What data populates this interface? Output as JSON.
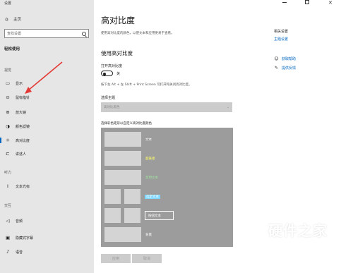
{
  "window": {
    "title": "设置",
    "close_glyph": "✕"
  },
  "sidebar": {
    "home_label": "主页",
    "search_placeholder": "查找设置",
    "section_title": "轻松使用",
    "groups": [
      {
        "label": "视觉"
      },
      {
        "label": "听力"
      },
      {
        "label": "交互"
      }
    ],
    "items": [
      {
        "label": "显示",
        "icon": "display-icon"
      },
      {
        "label": "鼠标指针",
        "icon": "pointer-icon"
      },
      {
        "label": "放大镜",
        "icon": "magnifier-icon"
      },
      {
        "label": "颜色滤镜",
        "icon": "color-filter-icon"
      },
      {
        "label": "高对比度",
        "icon": "contrast-icon"
      },
      {
        "label": "讲述人",
        "icon": "narrator-icon"
      },
      {
        "label": "文本光标",
        "icon": "text-cursor-icon"
      },
      {
        "label": "音频",
        "icon": "speaker-icon"
      },
      {
        "label": "隐藏式字幕",
        "icon": "captions-icon"
      },
      {
        "label": "语音",
        "icon": "microphone-icon"
      }
    ]
  },
  "main": {
    "title": "高对比度",
    "description": "使用高对比度的颜色，以使文本和应用更易于查看。",
    "section_title": "使用高对比度",
    "toggle_label": "打开高对比度",
    "toggle_state": "关",
    "hint": "按下左 Alt + 左 Shift + Print Screen 可打开和关闭高对比度。",
    "theme_label": "选择主题",
    "theme_value": "高对比黑色",
    "color_label": "选择彩色矩形以自定义高对比度颜色",
    "preview": {
      "text": "文本",
      "hyperlink": "超链接",
      "disabled_text": "禁用文本",
      "selected_text": "选定文本",
      "button_text": "按钮文本",
      "background": "背景"
    },
    "apply_label": "应用",
    "cancel_label": "取消"
  },
  "right": {
    "heading": "相关设置",
    "theme_link": "主题设置",
    "help_link": "获取帮助",
    "feedback_link": "提供反馈"
  },
  "watermark": {
    "main": "硬件之家",
    "sub": "YING JIAN ZHI JIA.COM"
  },
  "colors": {
    "sidebar_bg": "#e6e6e6",
    "accent": "#0067c0",
    "preview_bg": "#9c9c9c",
    "swatch": "#d4d4d4",
    "hyperlink": "#ffff66",
    "disabled": "#9fe59f",
    "selected_bg": "#7fd7ff",
    "annotation_arrow": "#e53935"
  }
}
